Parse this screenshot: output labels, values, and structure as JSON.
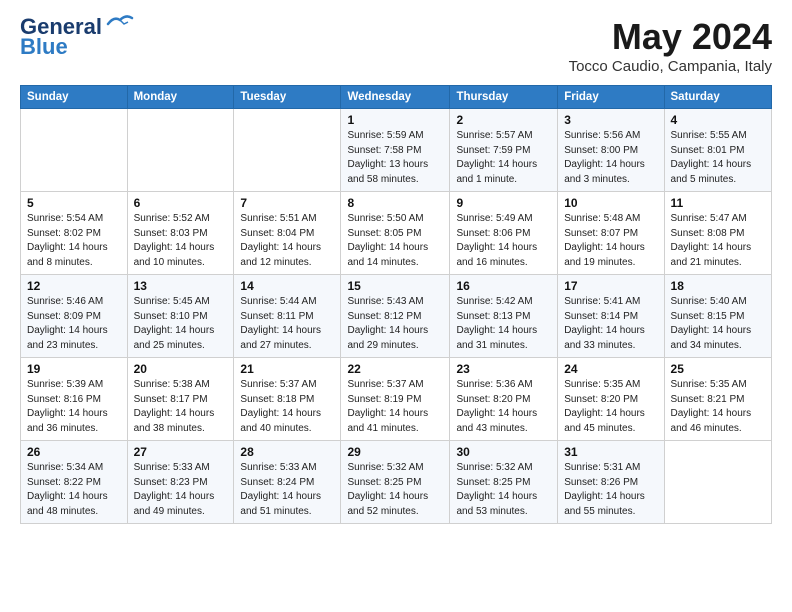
{
  "logo": {
    "line1": "General",
    "line2": "Blue"
  },
  "title": "May 2024",
  "location": "Tocco Caudio, Campania, Italy",
  "days_header": [
    "Sunday",
    "Monday",
    "Tuesday",
    "Wednesday",
    "Thursday",
    "Friday",
    "Saturday"
  ],
  "weeks": [
    [
      {
        "num": "",
        "sunrise": "",
        "sunset": "",
        "daylight": ""
      },
      {
        "num": "",
        "sunrise": "",
        "sunset": "",
        "daylight": ""
      },
      {
        "num": "",
        "sunrise": "",
        "sunset": "",
        "daylight": ""
      },
      {
        "num": "1",
        "sunrise": "Sunrise: 5:59 AM",
        "sunset": "Sunset: 7:58 PM",
        "daylight": "Daylight: 13 hours and 58 minutes."
      },
      {
        "num": "2",
        "sunrise": "Sunrise: 5:57 AM",
        "sunset": "Sunset: 7:59 PM",
        "daylight": "Daylight: 14 hours and 1 minute."
      },
      {
        "num": "3",
        "sunrise": "Sunrise: 5:56 AM",
        "sunset": "Sunset: 8:00 PM",
        "daylight": "Daylight: 14 hours and 3 minutes."
      },
      {
        "num": "4",
        "sunrise": "Sunrise: 5:55 AM",
        "sunset": "Sunset: 8:01 PM",
        "daylight": "Daylight: 14 hours and 5 minutes."
      }
    ],
    [
      {
        "num": "5",
        "sunrise": "Sunrise: 5:54 AM",
        "sunset": "Sunset: 8:02 PM",
        "daylight": "Daylight: 14 hours and 8 minutes."
      },
      {
        "num": "6",
        "sunrise": "Sunrise: 5:52 AM",
        "sunset": "Sunset: 8:03 PM",
        "daylight": "Daylight: 14 hours and 10 minutes."
      },
      {
        "num": "7",
        "sunrise": "Sunrise: 5:51 AM",
        "sunset": "Sunset: 8:04 PM",
        "daylight": "Daylight: 14 hours and 12 minutes."
      },
      {
        "num": "8",
        "sunrise": "Sunrise: 5:50 AM",
        "sunset": "Sunset: 8:05 PM",
        "daylight": "Daylight: 14 hours and 14 minutes."
      },
      {
        "num": "9",
        "sunrise": "Sunrise: 5:49 AM",
        "sunset": "Sunset: 8:06 PM",
        "daylight": "Daylight: 14 hours and 16 minutes."
      },
      {
        "num": "10",
        "sunrise": "Sunrise: 5:48 AM",
        "sunset": "Sunset: 8:07 PM",
        "daylight": "Daylight: 14 hours and 19 minutes."
      },
      {
        "num": "11",
        "sunrise": "Sunrise: 5:47 AM",
        "sunset": "Sunset: 8:08 PM",
        "daylight": "Daylight: 14 hours and 21 minutes."
      }
    ],
    [
      {
        "num": "12",
        "sunrise": "Sunrise: 5:46 AM",
        "sunset": "Sunset: 8:09 PM",
        "daylight": "Daylight: 14 hours and 23 minutes."
      },
      {
        "num": "13",
        "sunrise": "Sunrise: 5:45 AM",
        "sunset": "Sunset: 8:10 PM",
        "daylight": "Daylight: 14 hours and 25 minutes."
      },
      {
        "num": "14",
        "sunrise": "Sunrise: 5:44 AM",
        "sunset": "Sunset: 8:11 PM",
        "daylight": "Daylight: 14 hours and 27 minutes."
      },
      {
        "num": "15",
        "sunrise": "Sunrise: 5:43 AM",
        "sunset": "Sunset: 8:12 PM",
        "daylight": "Daylight: 14 hours and 29 minutes."
      },
      {
        "num": "16",
        "sunrise": "Sunrise: 5:42 AM",
        "sunset": "Sunset: 8:13 PM",
        "daylight": "Daylight: 14 hours and 31 minutes."
      },
      {
        "num": "17",
        "sunrise": "Sunrise: 5:41 AM",
        "sunset": "Sunset: 8:14 PM",
        "daylight": "Daylight: 14 hours and 33 minutes."
      },
      {
        "num": "18",
        "sunrise": "Sunrise: 5:40 AM",
        "sunset": "Sunset: 8:15 PM",
        "daylight": "Daylight: 14 hours and 34 minutes."
      }
    ],
    [
      {
        "num": "19",
        "sunrise": "Sunrise: 5:39 AM",
        "sunset": "Sunset: 8:16 PM",
        "daylight": "Daylight: 14 hours and 36 minutes."
      },
      {
        "num": "20",
        "sunrise": "Sunrise: 5:38 AM",
        "sunset": "Sunset: 8:17 PM",
        "daylight": "Daylight: 14 hours and 38 minutes."
      },
      {
        "num": "21",
        "sunrise": "Sunrise: 5:37 AM",
        "sunset": "Sunset: 8:18 PM",
        "daylight": "Daylight: 14 hours and 40 minutes."
      },
      {
        "num": "22",
        "sunrise": "Sunrise: 5:37 AM",
        "sunset": "Sunset: 8:19 PM",
        "daylight": "Daylight: 14 hours and 41 minutes."
      },
      {
        "num": "23",
        "sunrise": "Sunrise: 5:36 AM",
        "sunset": "Sunset: 8:20 PM",
        "daylight": "Daylight: 14 hours and 43 minutes."
      },
      {
        "num": "24",
        "sunrise": "Sunrise: 5:35 AM",
        "sunset": "Sunset: 8:20 PM",
        "daylight": "Daylight: 14 hours and 45 minutes."
      },
      {
        "num": "25",
        "sunrise": "Sunrise: 5:35 AM",
        "sunset": "Sunset: 8:21 PM",
        "daylight": "Daylight: 14 hours and 46 minutes."
      }
    ],
    [
      {
        "num": "26",
        "sunrise": "Sunrise: 5:34 AM",
        "sunset": "Sunset: 8:22 PM",
        "daylight": "Daylight: 14 hours and 48 minutes."
      },
      {
        "num": "27",
        "sunrise": "Sunrise: 5:33 AM",
        "sunset": "Sunset: 8:23 PM",
        "daylight": "Daylight: 14 hours and 49 minutes."
      },
      {
        "num": "28",
        "sunrise": "Sunrise: 5:33 AM",
        "sunset": "Sunset: 8:24 PM",
        "daylight": "Daylight: 14 hours and 51 minutes."
      },
      {
        "num": "29",
        "sunrise": "Sunrise: 5:32 AM",
        "sunset": "Sunset: 8:25 PM",
        "daylight": "Daylight: 14 hours and 52 minutes."
      },
      {
        "num": "30",
        "sunrise": "Sunrise: 5:32 AM",
        "sunset": "Sunset: 8:25 PM",
        "daylight": "Daylight: 14 hours and 53 minutes."
      },
      {
        "num": "31",
        "sunrise": "Sunrise: 5:31 AM",
        "sunset": "Sunset: 8:26 PM",
        "daylight": "Daylight: 14 hours and 55 minutes."
      },
      {
        "num": "",
        "sunrise": "",
        "sunset": "",
        "daylight": ""
      }
    ]
  ]
}
